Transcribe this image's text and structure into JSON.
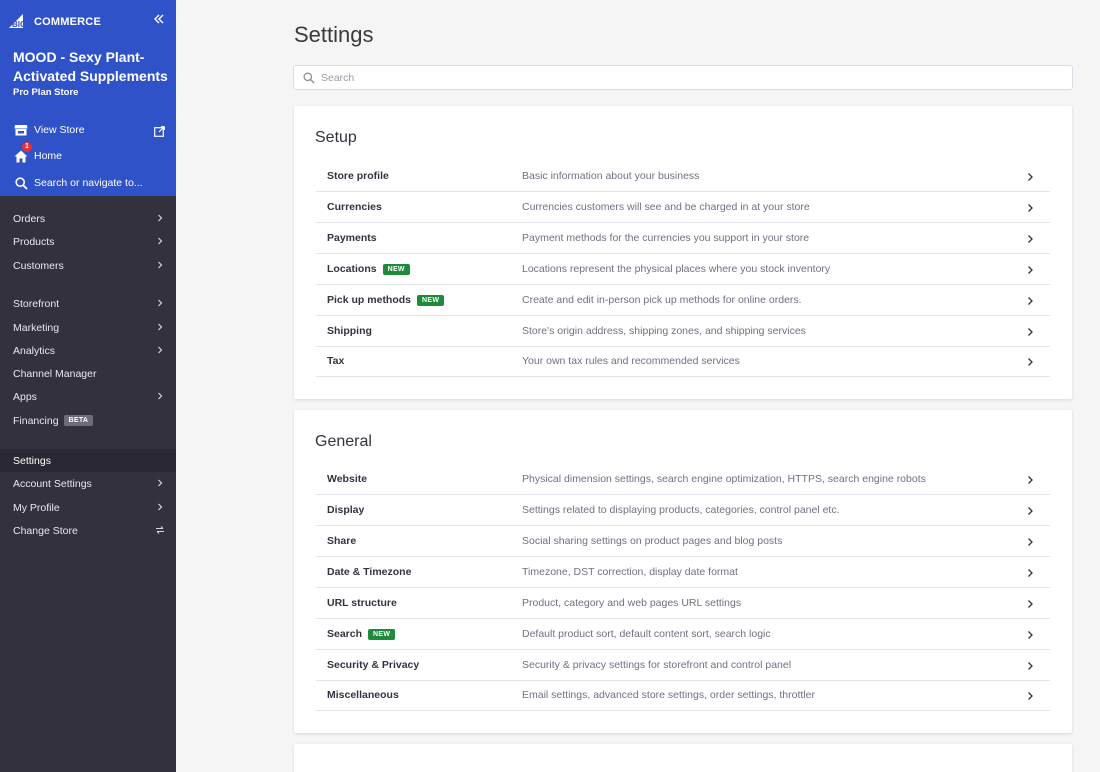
{
  "brand": {
    "logo_text": "COMMERCE",
    "logo_prefix": "BIG"
  },
  "store": {
    "name": "MOOD - Sexy Plant-Activated Supplements",
    "plan": "Pro Plan Store"
  },
  "top_links": {
    "view_store": "View Store",
    "home": "Home",
    "home_badge": "1",
    "search": "Search or navigate to..."
  },
  "nav": {
    "items": [
      {
        "label": "Orders",
        "chevron": true
      },
      {
        "label": "Products",
        "chevron": true
      },
      {
        "label": "Customers",
        "chevron": true
      },
      {
        "label": "Storefront",
        "chevron": true
      },
      {
        "label": "Marketing",
        "chevron": true
      },
      {
        "label": "Analytics",
        "chevron": true
      },
      {
        "label": "Channel Manager",
        "chevron": false
      },
      {
        "label": "Apps",
        "chevron": true
      },
      {
        "label": "Financing",
        "chevron": false,
        "badge": "BETA"
      },
      {
        "label": "Settings",
        "chevron": false,
        "active": true
      },
      {
        "label": "Account Settings",
        "chevron": true
      },
      {
        "label": "My Profile",
        "chevron": true
      },
      {
        "label": "Change Store",
        "chevron": false,
        "swap": true
      }
    ]
  },
  "page": {
    "title": "Settings",
    "search_placeholder": "Search"
  },
  "sections": {
    "setup": {
      "title": "Setup",
      "rows": [
        {
          "label": "Store profile",
          "desc": "Basic information about your business"
        },
        {
          "label": "Currencies",
          "desc": "Currencies customers will see and be charged in at your store"
        },
        {
          "label": "Payments",
          "desc": "Payment methods for the currencies you support in your store"
        },
        {
          "label": "Locations",
          "desc": "Locations represent the physical places where you stock inventory",
          "badge": "NEW"
        },
        {
          "label": "Pick up methods",
          "desc": "Create and edit in-person pick up methods for online orders.",
          "badge": "NEW"
        },
        {
          "label": "Shipping",
          "desc": "Store's origin address, shipping zones, and shipping services"
        },
        {
          "label": "Tax",
          "desc": "Your own tax rules and recommended services"
        }
      ]
    },
    "general": {
      "title": "General",
      "rows": [
        {
          "label": "Website",
          "desc": "Physical dimension settings, search engine optimization, HTTPS, search engine robots"
        },
        {
          "label": "Display",
          "desc": "Settings related to displaying products, categories, control panel etc."
        },
        {
          "label": "Share",
          "desc": "Social sharing settings on product pages and blog posts"
        },
        {
          "label": "Date & Timezone",
          "desc": "Timezone, DST correction, display date format"
        },
        {
          "label": "URL structure",
          "desc": "Product, category and web pages URL settings"
        },
        {
          "label": "Search",
          "desc": "Default product sort, default content sort, search logic",
          "badge": "NEW"
        },
        {
          "label": "Security & Privacy",
          "desc": "Security & privacy settings for storefront and control panel"
        },
        {
          "label": "Miscellaneous",
          "desc": "Email settings, advanced store settings, order settings, throttler"
        }
      ]
    }
  },
  "colors": {
    "sidebar_top": "#3052c8",
    "sidebar": "#34313f",
    "new_badge": "#1f8a3a",
    "notification": "#e0323d"
  }
}
